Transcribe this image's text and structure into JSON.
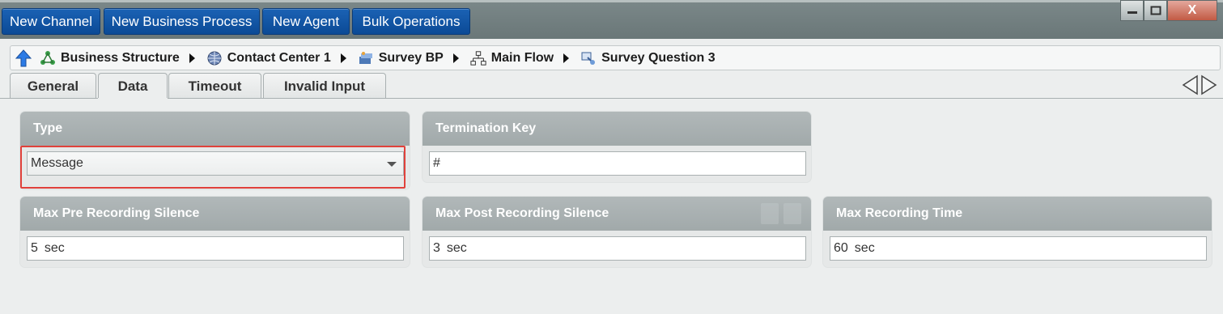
{
  "toolbar": {
    "buttons": [
      "New Channel",
      "New Business Process",
      "New Agent",
      "Bulk Operations"
    ]
  },
  "window_controls": {
    "minimize": "minimize-icon",
    "maximize": "maximize-icon",
    "close": "X"
  },
  "breadcrumb": {
    "items": [
      {
        "label": "Business Structure",
        "icon": "org-structure-icon"
      },
      {
        "label": "Contact Center 1",
        "icon": "globe-icon"
      },
      {
        "label": "Survey BP",
        "icon": "process-icon"
      },
      {
        "label": "Main Flow",
        "icon": "flow-tree-icon"
      },
      {
        "label": "Survey Question 3",
        "icon": "question-node-icon"
      }
    ]
  },
  "tabs": [
    {
      "label": "General",
      "active": false
    },
    {
      "label": "Data",
      "active": true
    },
    {
      "label": "Timeout",
      "active": false
    },
    {
      "label": "Invalid Input",
      "active": false
    }
  ],
  "panels": {
    "type": {
      "title": "Type",
      "value": "Message"
    },
    "termination_key": {
      "title": "Termination Key",
      "value": "#"
    },
    "max_pre": {
      "title": "Max Pre Recording Silence",
      "value": "5",
      "unit": "sec"
    },
    "max_post": {
      "title": "Max Post Recording Silence",
      "value": "3",
      "unit": "sec"
    },
    "max_time": {
      "title": "Max Recording Time",
      "value": "60",
      "unit": "sec"
    }
  },
  "colors": {
    "accent_button": "#1b62b4",
    "highlight": "#e0413b",
    "panel_header": "#a9b0b1"
  }
}
